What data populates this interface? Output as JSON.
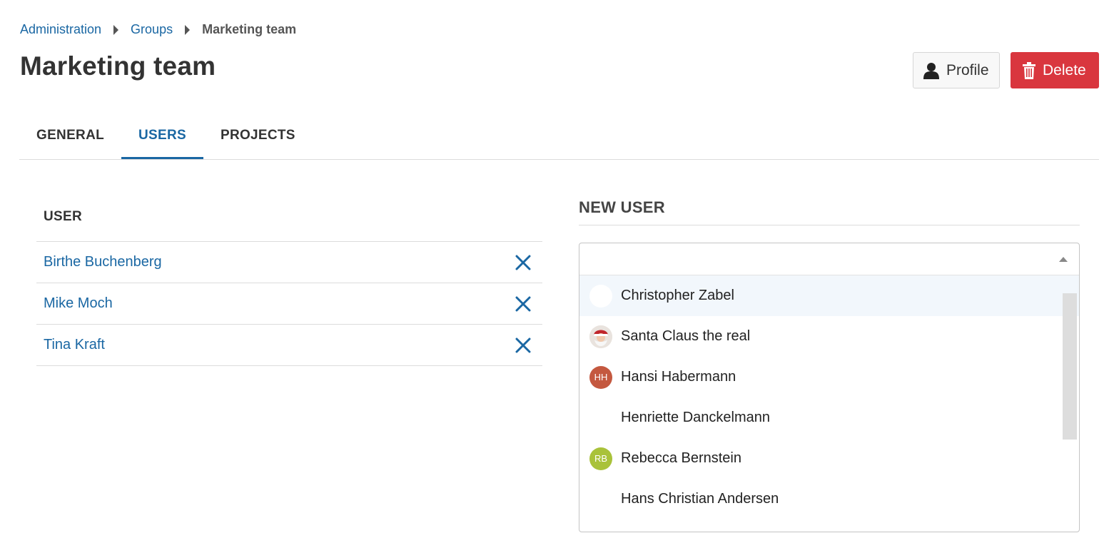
{
  "breadcrumb": {
    "items": [
      "Administration",
      "Groups"
    ],
    "current": "Marketing team"
  },
  "page": {
    "title": "Marketing team"
  },
  "toolbar": {
    "profile_label": "Profile",
    "profile_icon": "user-icon",
    "delete_label": "Delete",
    "delete_icon": "trash-icon",
    "delete_color": "#d9363e"
  },
  "tabs": [
    {
      "label": "GENERAL",
      "active": false
    },
    {
      "label": "USERS",
      "active": true
    },
    {
      "label": "PROJECTS",
      "active": false
    }
  ],
  "users_table": {
    "header": "USER",
    "rows": [
      {
        "name": "Birthe Buchenberg"
      },
      {
        "name": "Mike Moch"
      },
      {
        "name": "Tina Kraft"
      }
    ],
    "remove_icon": "close-icon"
  },
  "new_user": {
    "title": "NEW USER",
    "search_value": "",
    "options": [
      {
        "label": "Christopher Zabel",
        "avatar": ""
      },
      {
        "label": "Santa Claus the real",
        "avatar": ""
      },
      {
        "label": "Hansi Habermann",
        "avatar": "HH"
      },
      {
        "label": "Henriette Danckelmann",
        "avatar": ""
      },
      {
        "label": "Rebecca Bernstein",
        "avatar": "RB"
      },
      {
        "label": "Hans Christian Andersen",
        "avatar": ""
      }
    ]
  },
  "colors": {
    "link": "#1a67a3",
    "accent": "#1a67a3",
    "danger": "#d9363e",
    "avatar_hh": "#c4583f",
    "avatar_rb": "#a9c23a"
  }
}
